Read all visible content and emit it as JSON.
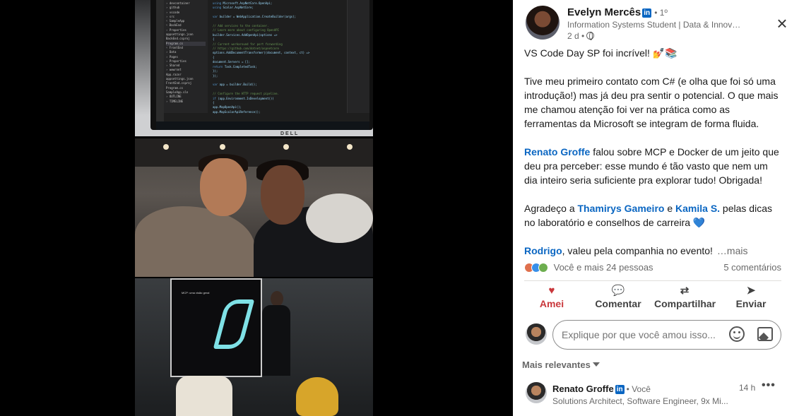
{
  "post": {
    "author_name": "Evelyn Mercês",
    "linkedin_badge": "in",
    "degree": "• 1º",
    "headline": "Information Systems Student | Data & Innovat...",
    "time": "2 d •",
    "close_icon": "×",
    "text": {
      "line1": "VS Code Day SP foi incrível! 💅📚",
      "para2": "Tive meu primeiro contato com C# (e olha que foi só uma introdução!) mas já deu pra sentir o potencial. O que mais me chamou atenção foi ver na prática como as ferramentas da Microsoft se integram de forma fluida.",
      "mention1": "Renato Groffe",
      "para3": " falou sobre MCP e Docker de um jeito que deu pra perceber: esse mundo é tão vasto que nem um dia inteiro seria suficiente pra explorar tudo! Obrigada!",
      "para4_start": "Agradeço a ",
      "mention2": "Thamirys Gameiro",
      "para4_mid": " e ",
      "mention3": "Kamila S.",
      "para4_end": " pelas dicas no laboratório e conselhos de carreira 💙",
      "mention4": "Rodrigo",
      "para5": ", valeu pela companhia no evento!",
      "more_label": "…mais"
    }
  },
  "social": {
    "reactions_text": "Você e mais 24 pessoas",
    "comments_text": "5 comentários"
  },
  "actions": [
    {
      "label": "Amei",
      "icon": "♥"
    },
    {
      "label": "Comentar",
      "icon": "💬"
    },
    {
      "label": "Compartilhar",
      "icon": "⇄"
    },
    {
      "label": "Enviar",
      "icon": "➤"
    }
  ],
  "comment_box": {
    "placeholder": "Explique por que você amou isso..."
  },
  "sort": {
    "label": "Mais relevantes"
  },
  "comment": {
    "name": "Renato Groffe",
    "badge": "in",
    "relation": "• Você",
    "headline": "Solutions Architect, Software Engineer, 9x Mi...",
    "time": "14 h",
    "menu": "•••"
  },
  "photos": {
    "monitor_brand": "DELL",
    "slide_title": "MCP: uma visão geral"
  },
  "colors": {
    "link": "#0a66c2",
    "love": "#c9373b"
  }
}
